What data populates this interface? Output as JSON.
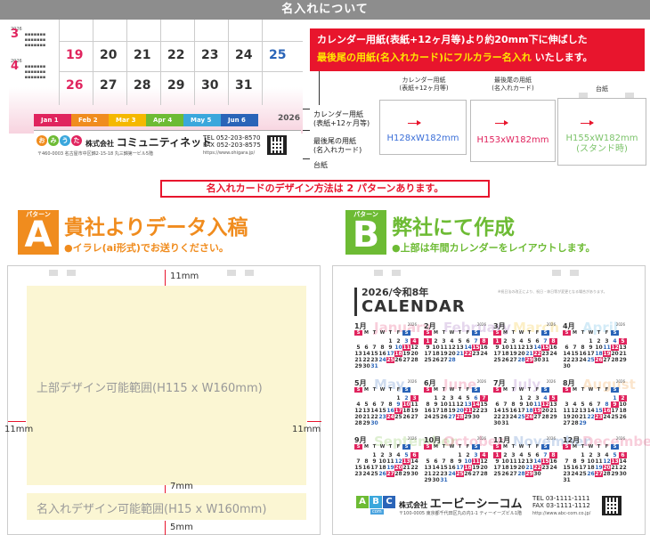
{
  "header": {
    "title": "名入れについて"
  },
  "preview": {
    "mini_year": "2026",
    "mini_month_3": "3",
    "mini_month_4": "4",
    "big_days": [
      "19",
      "20",
      "21",
      "22",
      "23",
      "24",
      "25",
      "26",
      "27",
      "28",
      "29",
      "30",
      "31"
    ],
    "months": [
      {
        "label": "Jan 1",
        "color": "#e0245e"
      },
      {
        "label": "Feb 2",
        "color": "#f08c1e"
      },
      {
        "label": "Mar 3",
        "color": "#f5b800"
      },
      {
        "label": "Apr 4",
        "color": "#6dbb34"
      },
      {
        "label": "May 5",
        "color": "#3ba7dc"
      },
      {
        "label": "Jun 6",
        "color": "#2a64b8"
      }
    ],
    "strip_year": "2026",
    "card_logo": [
      "お",
      "み",
      "う",
      "た",
      "ら"
    ],
    "card_company_prefix": "株式会社",
    "card_company_name": "コミュニティネット",
    "card_address": "〒460-0003 名古屋市中区錦2-15-18 丸三錦第一ビル5階",
    "card_tel": "TEL 052-203-8570",
    "card_fax": "FAX 052-203-8575",
    "card_url": "https://www.ohigara.jp/"
  },
  "layer_labels": {
    "calendar_paper_1": "カレンダー用紙",
    "calendar_paper_2": "(表紙+12ヶ月等)",
    "last_paper_1": "最後尾の用紙",
    "last_paper_2": "(名入れカード)",
    "base": "台紙"
  },
  "banner": {
    "line1": "カレンダー用紙(表紙+12ヶ月等)より約20mm下に伸ばした",
    "line2_yellow": "最後尾の用紙(名入れカード)にフルカラー名入れ",
    "line2_rest": " いたします。"
  },
  "sizes": [
    {
      "label1": "カレンダー用紙",
      "label2": "(表紙+12ヶ月等)",
      "dim": "H128xW182mm",
      "dim2": "",
      "color": "#3b6fd8"
    },
    {
      "label1": "最後尾の用紙",
      "label2": "(名入れカード)",
      "dim": "H153xW182mm",
      "dim2": "",
      "color": "#e0245e"
    },
    {
      "label1": "台紙",
      "label2": "",
      "dim": "H155xW182mm",
      "dim2": "(スタンド時)",
      "color": "#7cc36a"
    }
  ],
  "patterns_note": "名入れカードのデザイン方法は 2 パターンあります。",
  "pattern_a": {
    "tag": "パターン",
    "letter": "A",
    "color": "#f08c1e",
    "title": "貴社よりデータ入稿",
    "subtitle": "●イラレ(ai形式)でお送りください。",
    "upper_label": "上部デザイン可能範囲(H115 x W160mm)",
    "lower_label": "名入れデザイン可能範囲(H15 x W160mm)",
    "mm_top": "11mm",
    "mm_left": "11mm",
    "mm_right": "11mm",
    "mm_mid": "7mm",
    "mm_bottom": "5mm"
  },
  "pattern_b": {
    "tag": "パターン",
    "letter": "B",
    "color": "#6dbb34",
    "title": "弊社にて作成",
    "subtitle": "●上部は年間カレンダーをレイアウトします。",
    "year_label": "2026/令和8年",
    "calendar_word": "CALENDAR",
    "note": "※祝日法の改正により、祝日・休日等が変更となる場合があります。",
    "dow": [
      "S",
      "M",
      "T",
      "W",
      "T",
      "F",
      "S"
    ],
    "months": [
      {
        "num": "1月",
        "name": "January",
        "color": "#e0245e",
        "start": 4,
        "len": 31
      },
      {
        "num": "2月",
        "name": "February",
        "color": "#8e4fb0",
        "start": 0,
        "len": 28
      },
      {
        "num": "3月",
        "name": "March",
        "color": "#f5b800",
        "start": 0,
        "len": 31
      },
      {
        "num": "4月",
        "name": "April",
        "color": "#3ba7dc",
        "start": 3,
        "len": 30
      },
      {
        "num": "5月",
        "name": "May",
        "color": "#2a64b8",
        "start": 5,
        "len": 31
      },
      {
        "num": "6月",
        "name": "June",
        "color": "#e0245e",
        "start": 1,
        "len": 30
      },
      {
        "num": "7月",
        "name": "July",
        "color": "#8e4fb0",
        "start": 3,
        "len": 31
      },
      {
        "num": "8月",
        "name": "August",
        "color": "#f08c1e",
        "start": 6,
        "len": 31
      },
      {
        "num": "9月",
        "name": "September",
        "color": "#6dbb34",
        "start": 2,
        "len": 30
      },
      {
        "num": "10月",
        "name": "October",
        "color": "#e0245e",
        "start": 4,
        "len": 31
      },
      {
        "num": "11月",
        "name": "November",
        "color": "#2a64b8",
        "start": 0,
        "len": 30
      },
      {
        "num": "12月",
        "name": "December",
        "color": "#e0245e",
        "start": 2,
        "len": 31
      }
    ],
    "month_year": "2026",
    "footer_logo": [
      "A",
      "B",
      "C"
    ],
    "footer_logo_colors": [
      "#6dbb34",
      "#3ba7dc",
      "#2a64b8"
    ],
    "footer_com": "com",
    "footer_company_prefix": "株式会社",
    "footer_company_name": "エービーシーコム",
    "footer_address": "〒100-0005 東京都千代田区丸の内1-1 ティーイーズビル1階",
    "footer_tel": "TEL 03-1111-1111",
    "footer_fax": "FAX 03-1111-1112",
    "footer_url": "http://www.abc-com.co.jp/"
  },
  "colors": {
    "accent_red": "#e8152d",
    "orange": "#f08c1e",
    "green": "#6dbb34"
  }
}
